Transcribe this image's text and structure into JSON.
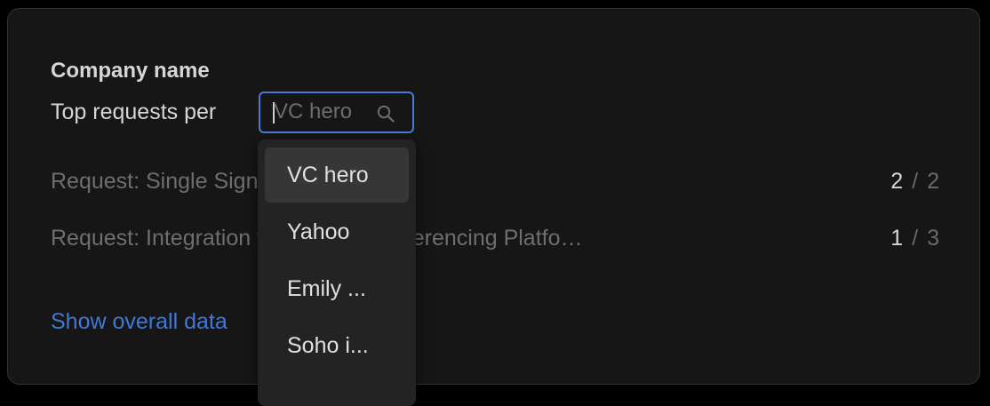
{
  "card": {
    "title": "Company name",
    "subtitle": "Top requests per"
  },
  "search": {
    "value": "",
    "placeholder": "VC hero",
    "icon": "search-icon"
  },
  "requests": [
    {
      "label": "Request: Single Sign-On Integration",
      "current": "2",
      "separator": "/",
      "total": "2"
    },
    {
      "label": "Request: Integration with Video Conferencing Platfo…",
      "current": "1",
      "separator": "/",
      "total": "3"
    }
  ],
  "show_overall_label": "Show overall data",
  "dropdown": {
    "options": [
      "VC hero",
      "Yahoo",
      "Emily ...",
      "Soho i..."
    ],
    "highlighted": "VC hero"
  },
  "colors": {
    "accent": "#4a7bd0",
    "link": "#3f78d6",
    "background": "#161616"
  }
}
